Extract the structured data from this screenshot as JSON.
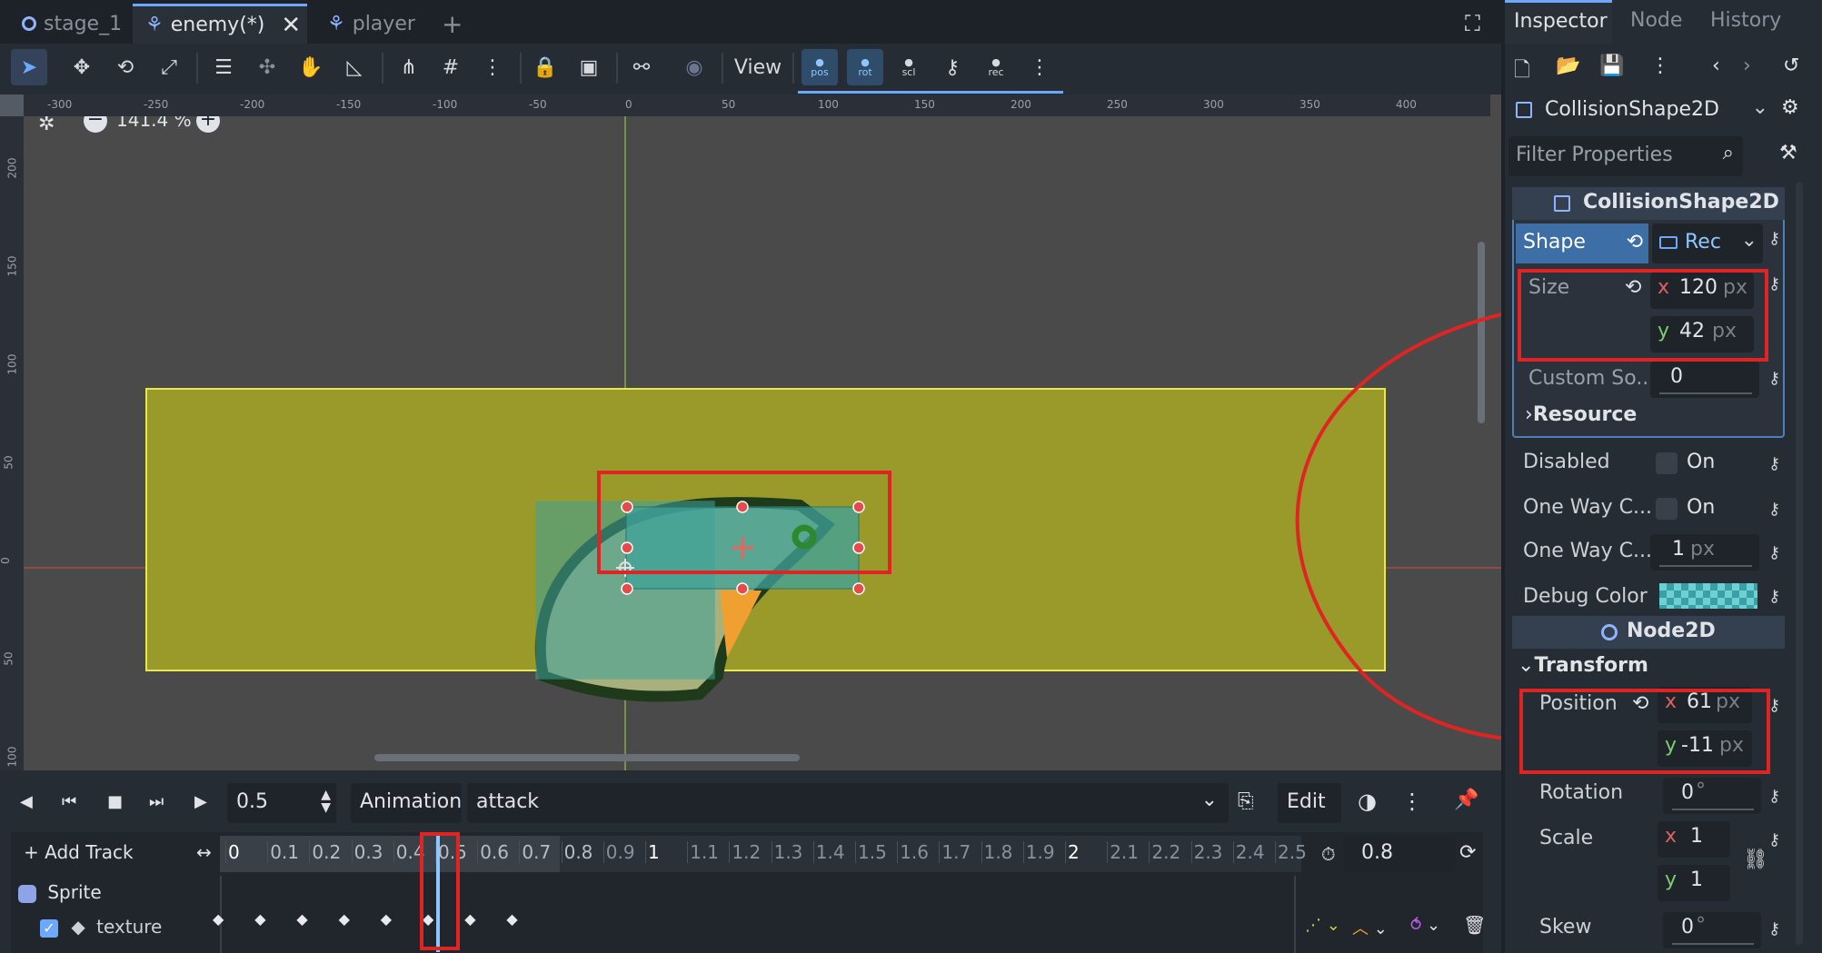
{
  "tabs": [
    {
      "label": "stage_1",
      "icon": "circle-node-icon"
    },
    {
      "label": "enemy(*)",
      "icon": "scene-icon"
    },
    {
      "label": "player",
      "icon": "scene-icon"
    }
  ],
  "toolbar": {
    "view_label": "View",
    "pos_label": "pos",
    "rot_label": "rot",
    "scl_label": "scl",
    "rec_label": "rec"
  },
  "viewport": {
    "zoom": "141.4 %",
    "ruler_h": [
      "-300",
      "-250",
      "-200",
      "-150",
      "-100",
      "-50",
      "0",
      "50",
      "100",
      "150",
      "200",
      "250",
      "300",
      "350",
      "400"
    ],
    "ruler_v": [
      "200",
      "150",
      "100",
      "50",
      "0",
      "50",
      "100"
    ]
  },
  "animation": {
    "time": "0.5",
    "animation_label": "Animation",
    "animation_name": "attack",
    "edit_label": "Edit",
    "add_track_label": "Add Track",
    "length": "0.8",
    "ticks": [
      "0",
      "0.1",
      "0.2",
      "0.3",
      "0.4",
      "0.5",
      "0.6",
      "0.7",
      "0.8",
      "0.9",
      "1",
      "1.1",
      "1.2",
      "1.3",
      "1.4",
      "1.5",
      "1.6",
      "1.7",
      "1.8",
      "1.9",
      "2",
      "2.1",
      "2.2",
      "2.3",
      "2.4",
      "2.5"
    ],
    "track_node": "Sprite",
    "track_prop": "texture"
  },
  "inspector": {
    "tabs": [
      "Inspector",
      "Node",
      "History"
    ],
    "node_type": "CollisionShape2D",
    "filter_placeholder": "Filter Properties",
    "section_title": "CollisionShape2D",
    "shape_label": "Shape",
    "shape_value": "Rec",
    "size_label": "Size",
    "size_x": "120",
    "size_y": "42",
    "unit_px": "px",
    "custom_solver_label": "Custom So...",
    "custom_solver_value": "0",
    "resource_label": "Resource",
    "disabled_label": "Disabled",
    "on_label": "On",
    "one_way_label": "One Way C...",
    "one_way_margin_value": "1",
    "debug_color_label": "Debug Color",
    "node2d_title": "Node2D",
    "transform_label": "Transform",
    "position_label": "Position",
    "pos_x": "61",
    "pos_y": "-11",
    "rotation_label": "Rotation",
    "rotation_value": "0",
    "deg": "°",
    "scale_label": "Scale",
    "scale_x": "1",
    "scale_y": "1",
    "skew_label": "Skew",
    "skew_value": "0",
    "x": "x",
    "y": "y"
  },
  "colors": {
    "accent": "#6da8ff",
    "highlight": "#e02424",
    "shape_fill": "#9a9a2b",
    "collision": "#3fa39a"
  }
}
